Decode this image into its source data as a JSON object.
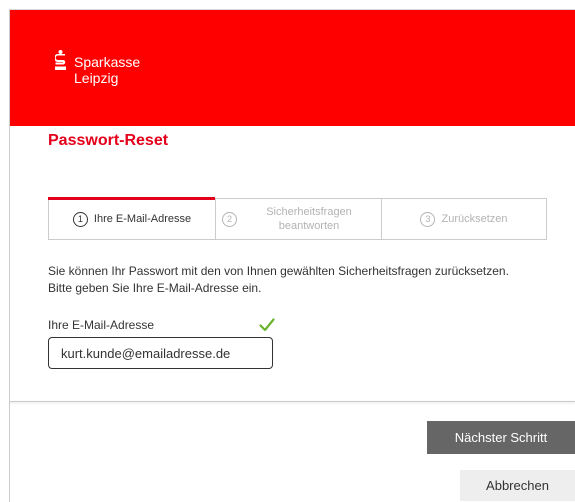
{
  "brand": {
    "name_line1": "Sparkasse",
    "name_line2": "Leipzig",
    "header_color": "#ff0000",
    "accent_color": "#e3001b",
    "icon": "sparkasse-s-icon"
  },
  "page": {
    "title": "Passwort-Reset"
  },
  "steps": [
    {
      "number": "1",
      "label": "Ihre E-Mail-Adresse",
      "active": true
    },
    {
      "number": "2",
      "label": "Sicherheitsfragen beantworten",
      "active": false
    },
    {
      "number": "3",
      "label": "Zurücksetzen",
      "active": false
    }
  ],
  "form": {
    "description_line1": "Sie können Ihr Passwort mit den von Ihnen gewählten Sicherheitsfragen zurücksetzen.",
    "description_line2": "Bitte geben Sie Ihre E-Mail-Adresse ein.",
    "email_label": "Ihre E-Mail-Adresse",
    "email_value": "kurt.kunde@emailadresse.de",
    "valid_icon": "checkmark-icon",
    "valid_color": "#6ab42d"
  },
  "actions": {
    "next_label": "Nächster Schritt",
    "cancel_label": "Abbrechen"
  }
}
